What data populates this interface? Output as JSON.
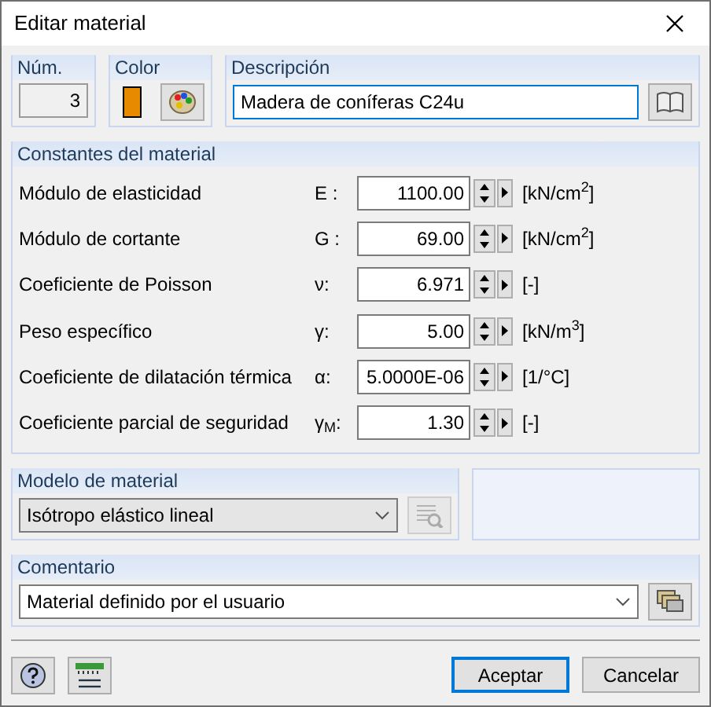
{
  "window": {
    "title": "Editar material"
  },
  "number": {
    "label": "Núm.",
    "value": "3"
  },
  "color": {
    "label": "Color",
    "color": "#e88a00"
  },
  "description": {
    "label": "Descripción",
    "value": "Madera de coníferas C24u"
  },
  "constants": {
    "title": "Constantes del material",
    "rows": [
      {
        "label": "Módulo de elasticidad",
        "symbol": "E :",
        "value": "1100.00",
        "unit": "[kN/cm$^{2}$]"
      },
      {
        "label": "Módulo de cortante",
        "symbol": "G :",
        "value": "69.00",
        "unit": "[kN/cm$^{2}$]"
      },
      {
        "label": "Coeficiente de Poisson",
        "symbol": "ν:",
        "value": "6.971",
        "unit": "[-]"
      },
      {
        "label": "Peso específico",
        "symbol": "γ:",
        "value": "5.00",
        "unit": "[kN/m$^{3}$]"
      },
      {
        "label": "Coeficiente de dilatación térmica",
        "symbol": "α:",
        "value": "5.0000E-06",
        "unit": "[1/°C]"
      },
      {
        "label": "Coeficiente parcial de seguridad",
        "symbol": "γ$_{M}$:",
        "value": "1.30",
        "unit": "[-]"
      }
    ]
  },
  "model": {
    "title": "Modelo de material",
    "value": "Isótropo elástico lineal",
    "disabled": true
  },
  "comment": {
    "title": "Comentario",
    "value": "Material definido por el usuario"
  },
  "buttons": [
    {
      "label": "Aceptar",
      "default": true
    },
    {
      "label": "Cancelar",
      "default": false
    }
  ]
}
